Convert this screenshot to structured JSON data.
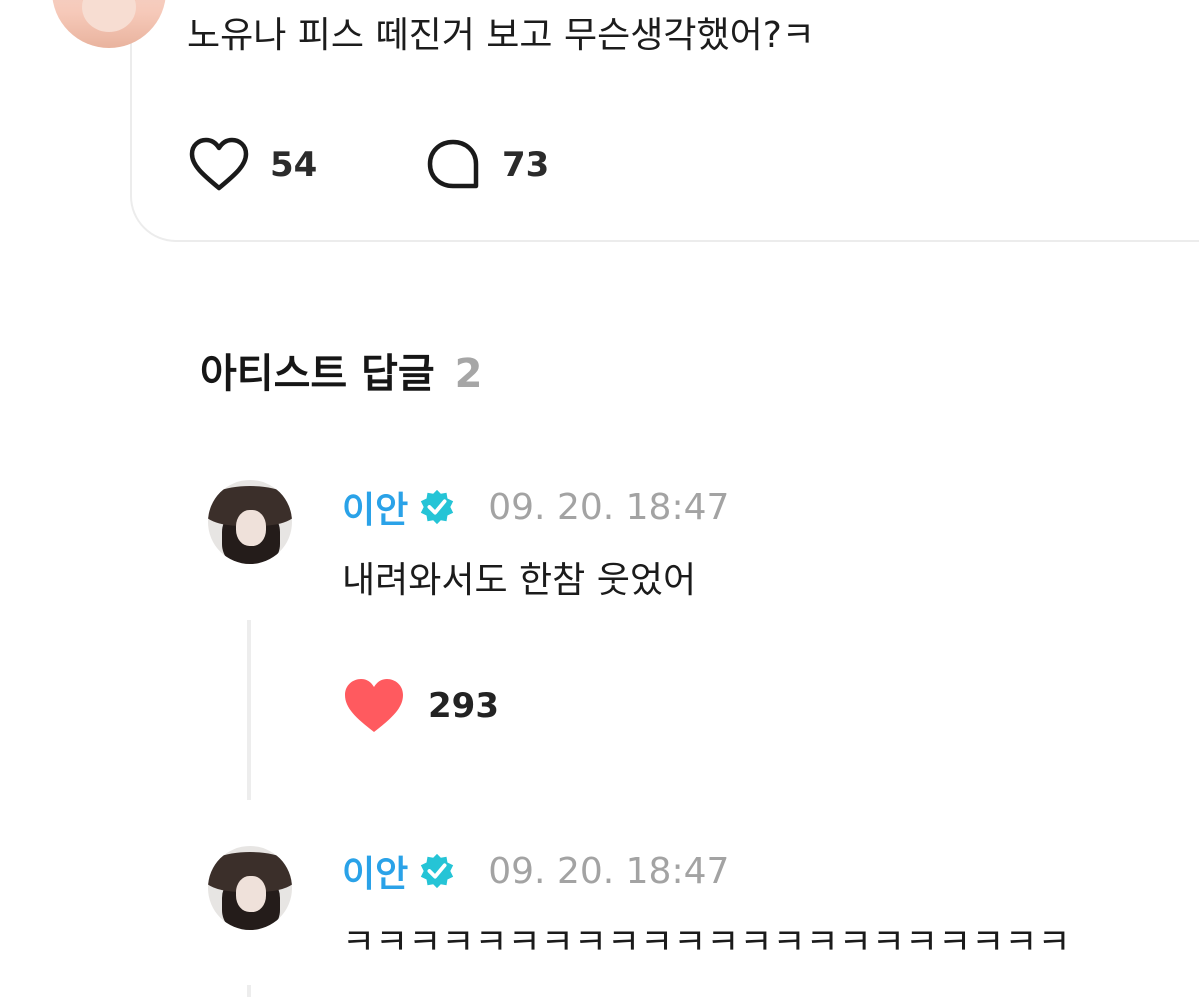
{
  "post": {
    "text": "노유나 피스 떼진거 보고 무슨생각했어?ㅋ",
    "likes": "54",
    "comments": "73"
  },
  "artist_replies": {
    "title": "아티스트 답글",
    "count": "2",
    "items": [
      {
        "name": "이안",
        "time": "09. 20. 18:47",
        "text": "내려와서도 한참 웃었어",
        "likes": "293"
      },
      {
        "name": "이안",
        "time": "09. 20. 18:47",
        "text": "ㅋㅋㅋㅋㅋㅋㅋㅋㅋㅋㅋㅋㅋㅋㅋㅋㅋㅋㅋㅋㅋㅋ"
      }
    ]
  },
  "colors": {
    "artist_name": "#2aa2e8",
    "verified_badge": "#25c4d6",
    "liked_heart": "#ff5a5f",
    "timestamp": "#a3a3a3"
  }
}
